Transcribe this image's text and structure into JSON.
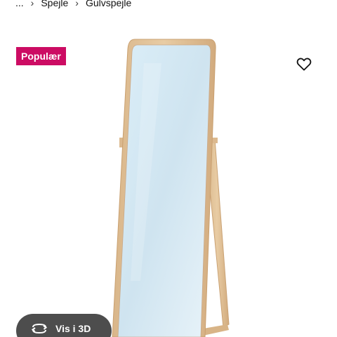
{
  "breadcrumb": {
    "items": [
      "...",
      "Spejle",
      "Gulvspejle"
    ],
    "separator": "›"
  },
  "badge": {
    "label": "Populær",
    "color": "#cc0c63"
  },
  "favorite": {
    "icon": "heart-outline-icon"
  },
  "product_image": {
    "subject": "standing floor mirror with light wood frame"
  },
  "view_3d": {
    "label": "Vis i 3D",
    "icon": "rotate-3d-icon"
  }
}
